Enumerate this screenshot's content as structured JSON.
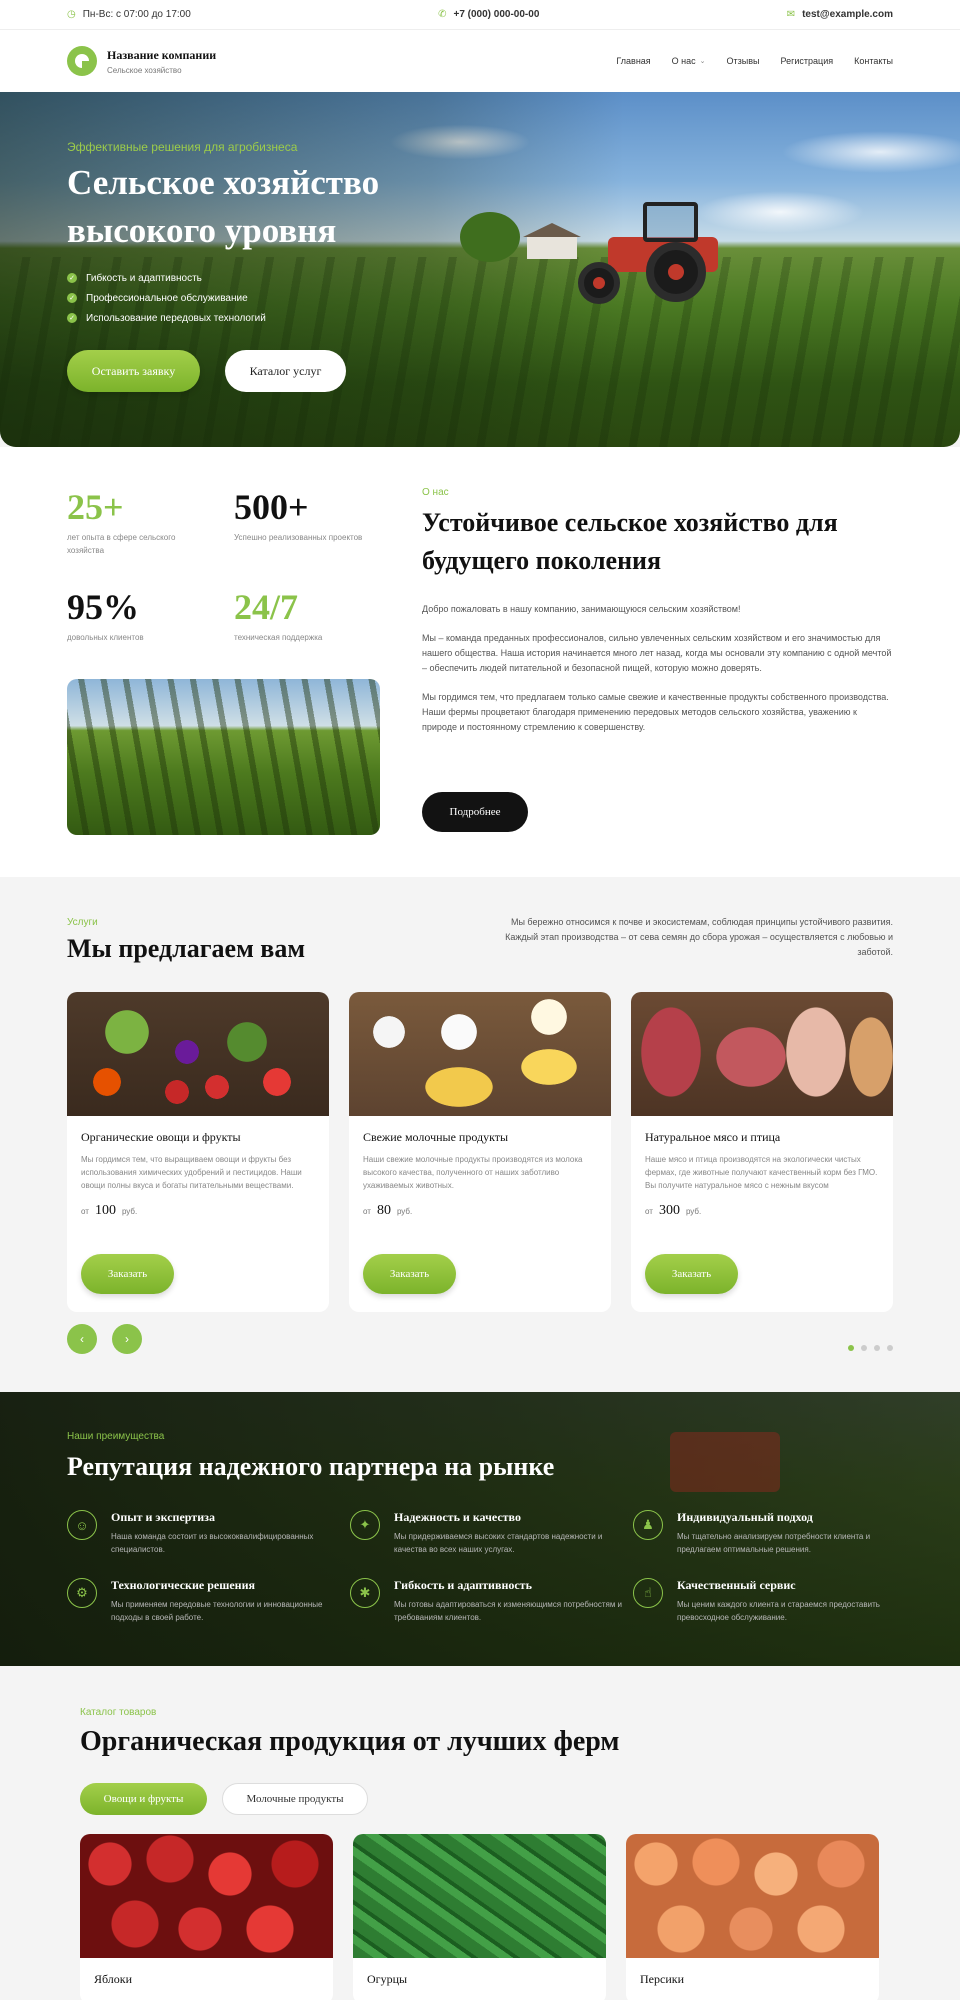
{
  "topbar": {
    "hours": "Пн-Вс: с 07:00 до 17:00",
    "phone": "+7 (000) 000-00-00",
    "email": "test@example.com"
  },
  "header": {
    "company_name": "Название компании",
    "company_tagline": "Сельское хозяйство",
    "nav": [
      "Главная",
      "О нас",
      "Отзывы",
      "Регистрация",
      "Контакты"
    ]
  },
  "hero": {
    "kicker": "Эффективные решения для агробизнеса",
    "title_line1": "Сельское хозяйство",
    "title_line2": "высокого уровня",
    "features": [
      "Гибкость и адаптивность",
      "Профессиональное обслуживание",
      "Использование передовых технологий"
    ],
    "primary_button": "Оставить заявку",
    "secondary_button": "Каталог услуг"
  },
  "about": {
    "stats": [
      {
        "value": "25+",
        "label": "лет опыта в сфере сельского хозяйства"
      },
      {
        "value": "500+",
        "label": "Успешно реализованных проектов"
      },
      {
        "value": "95%",
        "label": "довольных клиентов"
      },
      {
        "value": "24/7",
        "label": "техническая поддержка"
      }
    ],
    "kicker": "О нас",
    "title": "Устойчивое сельское хозяйство для будущего поколения",
    "paragraphs": [
      "Добро пожаловать в нашу компанию, занимающуюся сельским хозяйством!",
      "Мы – команда преданных профессионалов, сильно увлеченных сельским хозяйством и его значимостью для нашего общества. Наша история начинается много лет назад, когда мы основали эту компанию с одной мечтой – обеспечить людей питательной и безопасной пищей, которую можно доверять.",
      "Мы гордимся тем, что предлагаем только самые свежие и качественные продукты собственного производства. Наши фермы процветают благодаря применению передовых методов сельского хозяйства, уважению к природе и постоянному стремлению к совершенству."
    ],
    "button": "Подробнее"
  },
  "services": {
    "kicker": "Услуги",
    "title": "Мы предлагаем вам",
    "description": "Мы бережно относимся к почве и экосистемам, соблюдая принципы устойчивого развития. Каждый этап производства – от сева семян до сбора урожая – осуществляется с любовью и заботой.",
    "price_prefix": "от",
    "currency": "руб.",
    "order_label": "Заказать",
    "cards": [
      {
        "title": "Органические овощи и фрукты",
        "text": "Мы гордимся тем, что выращиваем овощи и фрукты без использования химических удобрений и пестицидов. Наши овощи полны вкуса и богаты питательными веществами.",
        "price": "100"
      },
      {
        "title": "Свежие молочные продукты",
        "text": "Наши свежие молочные продукты производятся из молока высокого качества, полученного от наших заботливо ухаживаемых животных.",
        "price": "80"
      },
      {
        "title": "Натуральное мясо и птица",
        "text": "Наше мясо и птица производятся на экологически чистых фермах, где животные получают качественный корм без ГМО. Вы получите натуральное мясо с нежным вкусом",
        "price": "300"
      }
    ],
    "prev_arrow": "‹",
    "next_arrow": "›"
  },
  "advantages": {
    "kicker": "Наши преимущества",
    "title": "Репутация надежного партнера на рынке",
    "items": [
      {
        "title": "Опыт и экспертиза",
        "text": "Наша команда состоит из высококвалифицированных специалистов."
      },
      {
        "title": "Надежность и качество",
        "text": "Мы придерживаемся высоких стандартов надежности и качества во всех наших услугах."
      },
      {
        "title": "Индивидуальный подход",
        "text": "Мы тщательно анализируем потребности клиента и предлагаем оптимальные решения."
      },
      {
        "title": "Технологические решения",
        "text": "Мы применяем передовые технологии и инновационные подходы в своей работе."
      },
      {
        "title": "Гибкость и адаптивность",
        "text": "Мы готовы адаптироваться к изменяющимся потребностям и требованиям клиентов."
      },
      {
        "title": "Качественный сервис",
        "text": "Мы ценим каждого клиента и стараемся предоставить превосходное обслуживание."
      }
    ]
  },
  "catalog": {
    "kicker": "Каталог товаров",
    "title": "Органическая продукция от лучших ферм",
    "tabs": [
      "Овощи и фрукты",
      "Молочные продукты"
    ],
    "products": [
      "Яблоки",
      "Огурцы",
      "Персики"
    ]
  },
  "colors": {
    "accent": "#8bc34a",
    "dark": "#121212"
  }
}
